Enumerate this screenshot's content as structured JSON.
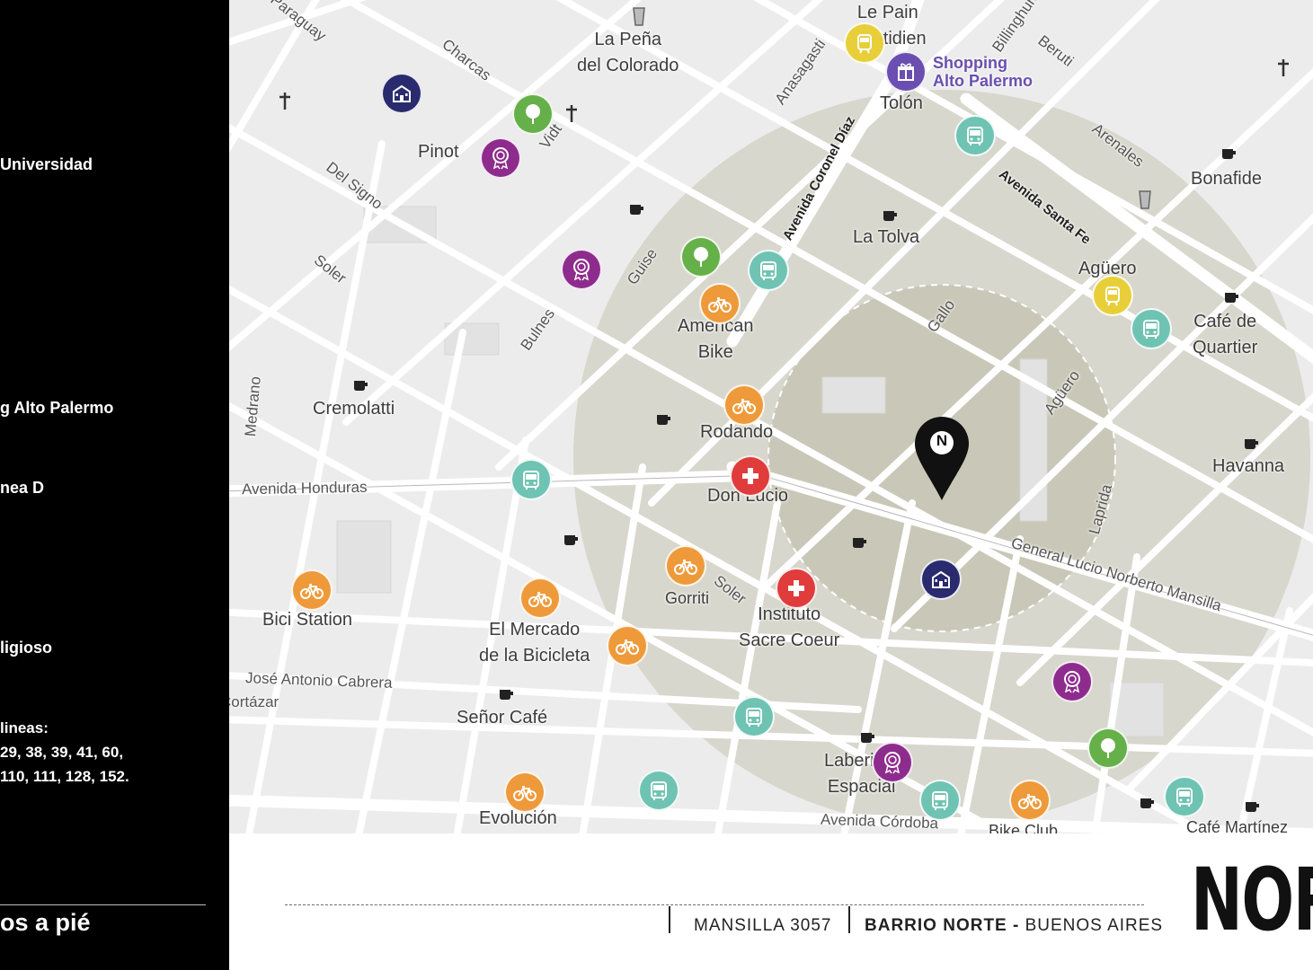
{
  "sidebar": {
    "labels": [
      "Universidad",
      "g Alto Palermo",
      "nea D",
      "ligioso"
    ],
    "bus_lines": [
      "lineas:",
      "29, 38, 39, 41, 60,",
      "110, 111, 128, 152."
    ],
    "walk_label": "os a pié"
  },
  "map": {
    "place_labels": {
      "la_pena": "La Peña\ndel Colorado",
      "le_pain": "Le Pain\nQuotidien",
      "shopping": "Shopping\nAlto Palermo",
      "tolon": "Tolón",
      "pinot": "Pinot",
      "bonafide": "Bonafide",
      "la_tolva": "La Tolva",
      "aguero_place": "Agüero",
      "cafe_quartier": "Café de\nQuartier",
      "american_bike": "American\nBike",
      "cremolatti": "Cremolatti",
      "rodando": "Rodando",
      "havanna": "Havanna",
      "don_lucio": "Don Lucio",
      "bici_station": "Bici Station",
      "el_mercado": "El Mercado\nde la Bicicleta",
      "gorriti_place": "Gorriti",
      "instituto": "Instituto\nSacre Coeur",
      "senor_cafe": "Señor Café",
      "laberinto": "Laberinto\nEspacial",
      "evolucion": "Evolución",
      "bike_club": "Bike Club",
      "cafe_martinez": "Café Martínez"
    },
    "street_labels": {
      "paraguay": "Paraguay",
      "charcas": "Charcas",
      "vidt": "Vidt",
      "anasagasti": "Anasagasti",
      "billinghurst": "Billinghurst",
      "beruti": "Beruti",
      "arenales": "Arenales",
      "del_signo": "Del Signo",
      "soler_top": "Soler",
      "guise": "Guise",
      "bulnes": "Bulnes",
      "gallo": "Gallo",
      "aguero_street": "Agüero",
      "medrano": "Medrano",
      "honduras": "Avenida Honduras",
      "laprida": "Laprida",
      "mansilla": "General Lucio Norberto Mansilla",
      "soler_bottom": "Soler",
      "cabrera": "José Antonio Cabrera",
      "cortazar": "Cortázar",
      "cordoba": "Avenida Córdoba",
      "coronel_diaz": "Avenida Coronel Díaz",
      "santa_fe": "Avenida Santa Fe"
    },
    "marker_letter": "N",
    "poi_icons": [
      {
        "type": "train",
        "name": "train-icon",
        "color": "#e8cf3a"
      },
      {
        "type": "shopping",
        "name": "gift-icon",
        "color": "#6a4fb0"
      },
      {
        "type": "school",
        "name": "school-icon",
        "color": "#2a2a6e"
      },
      {
        "type": "park",
        "name": "tree-icon",
        "color": "#66b04a"
      },
      {
        "type": "museum",
        "name": "rosette-icon",
        "color": "#8e2c8e"
      },
      {
        "type": "bus",
        "name": "bus-icon",
        "color": "#6fc3b2"
      },
      {
        "type": "bike",
        "name": "bicycle-icon",
        "color": "#ee9a3a"
      },
      {
        "type": "hospital",
        "name": "cross-icon",
        "color": "#e03c3c"
      }
    ]
  },
  "footer": {
    "address": "MANSILLA 3057",
    "neighborhood": "BARRIO NORTE -",
    "city": "BUENOS AIRES",
    "brand": "NOR"
  }
}
